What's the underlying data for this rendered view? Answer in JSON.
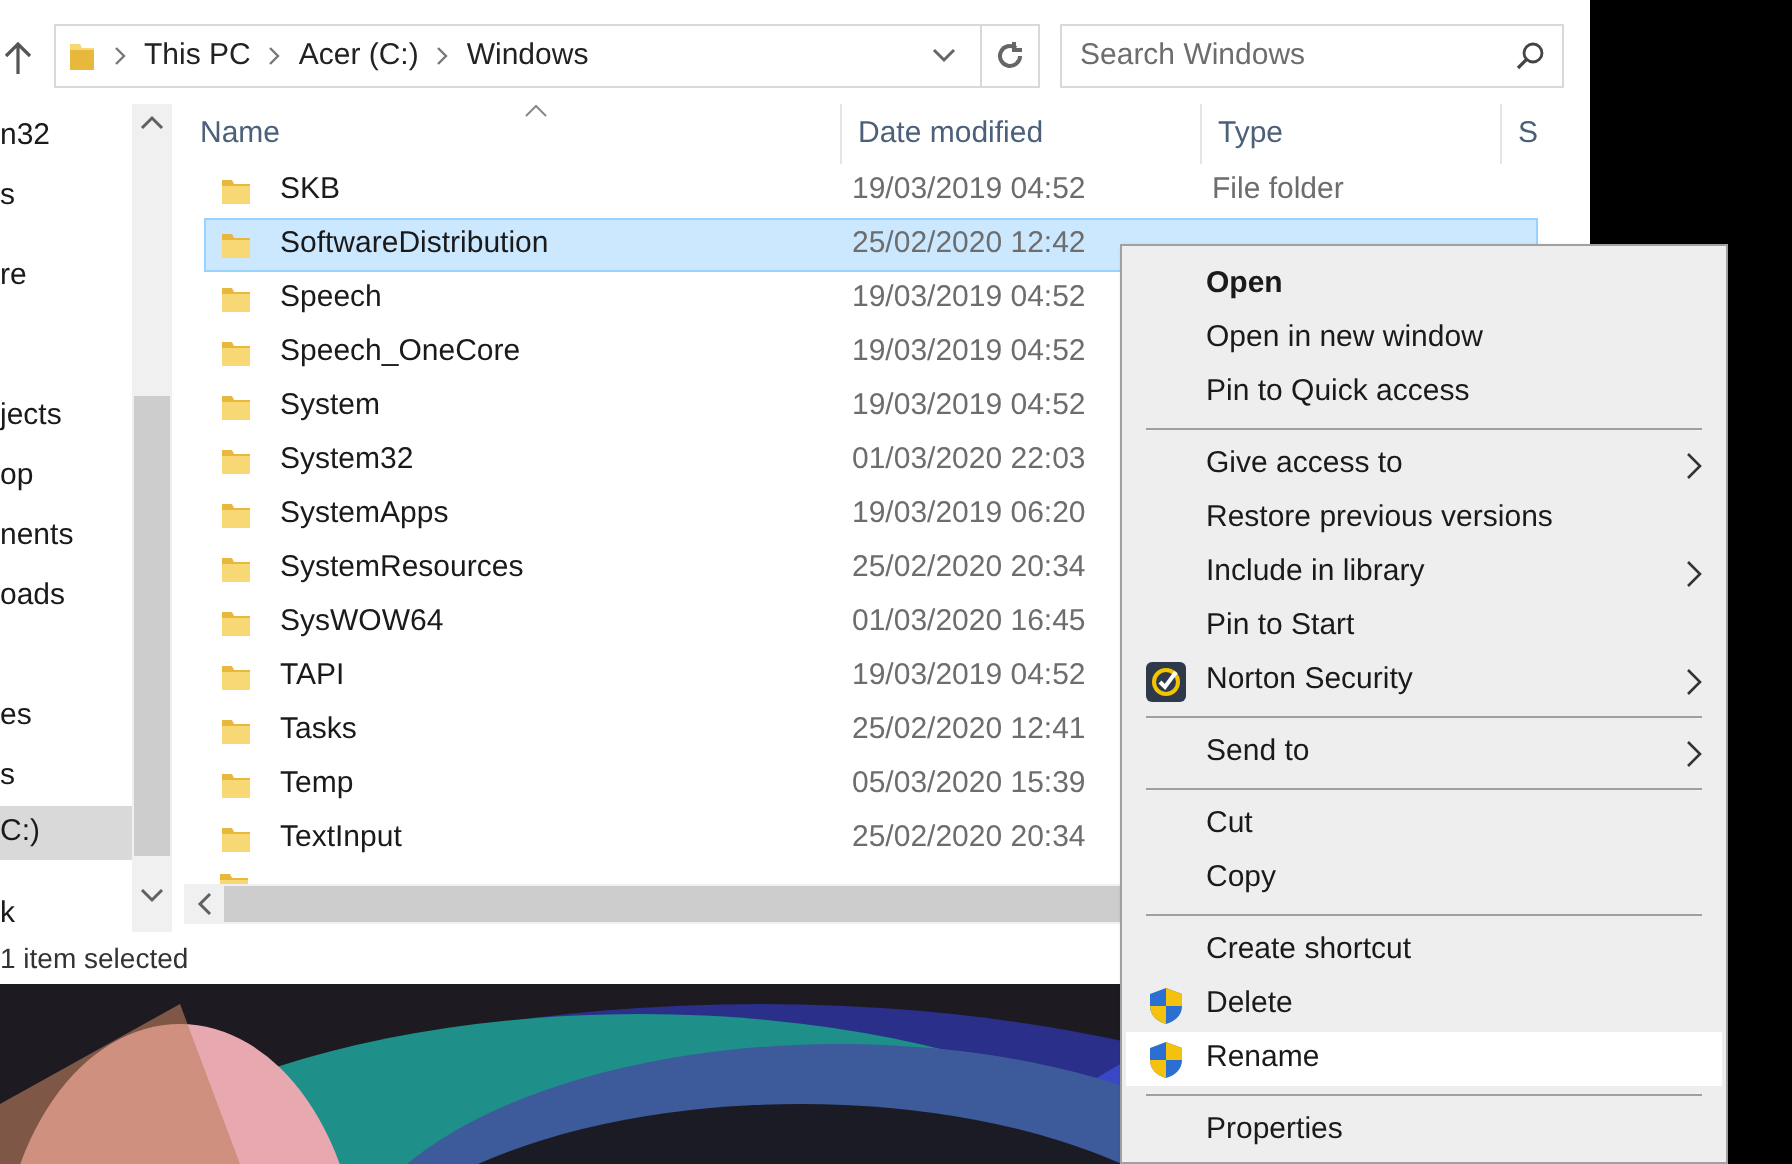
{
  "address_bar": {
    "crumbs": [
      "This PC",
      "Acer (C:)",
      "Windows"
    ]
  },
  "search": {
    "placeholder": "Search Windows"
  },
  "navigation_pane": {
    "items": [
      {
        "label": "n32",
        "selected": false
      },
      {
        "label": "s",
        "selected": false
      },
      {
        "label": "re",
        "selected": false
      },
      {
        "label": "jects",
        "selected": false
      },
      {
        "label": "op",
        "selected": false
      },
      {
        "label": "nents",
        "selected": false
      },
      {
        "label": "oads",
        "selected": false
      },
      {
        "label": "es",
        "selected": false
      },
      {
        "label": "s",
        "selected": false
      },
      {
        "label": "C:)",
        "selected": true
      },
      {
        "label": "k",
        "selected": false
      }
    ]
  },
  "file_list": {
    "columns": [
      "Name",
      "Date modified",
      "Type",
      "S"
    ],
    "rows": [
      {
        "name": "SKB",
        "date": "19/03/2019 04:52",
        "type": "File folder",
        "selected": false
      },
      {
        "name": "SoftwareDistribution",
        "date": "25/02/2020 12:42",
        "selected": true
      },
      {
        "name": "Speech",
        "date": "19/03/2019 04:52",
        "selected": false
      },
      {
        "name": "Speech_OneCore",
        "date": "19/03/2019 04:52",
        "selected": false
      },
      {
        "name": "System",
        "date": "19/03/2019 04:52",
        "selected": false
      },
      {
        "name": "System32",
        "date": "01/03/2020 22:03",
        "selected": false
      },
      {
        "name": "SystemApps",
        "date": "19/03/2019 06:20",
        "selected": false
      },
      {
        "name": "SystemResources",
        "date": "25/02/2020 20:34",
        "selected": false
      },
      {
        "name": "SysWOW64",
        "date": "01/03/2020 16:45",
        "selected": false
      },
      {
        "name": "TAPI",
        "date": "19/03/2019 04:52",
        "selected": false
      },
      {
        "name": "Tasks",
        "date": "25/02/2020 12:41",
        "selected": false
      },
      {
        "name": "Temp",
        "date": "05/03/2020 15:39",
        "selected": false
      },
      {
        "name": "TextInput",
        "date": "25/02/2020 20:34",
        "selected": false
      }
    ]
  },
  "status_bar": {
    "text": "1 item selected"
  },
  "context_menu": {
    "items": [
      {
        "kind": "item",
        "label": "Open",
        "default": true,
        "submenu": false,
        "selected": false
      },
      {
        "kind": "item",
        "label": "Open in new window",
        "default": false,
        "submenu": false,
        "selected": false
      },
      {
        "kind": "item",
        "label": "Pin to Quick access",
        "default": false,
        "submenu": false,
        "selected": false
      },
      {
        "kind": "separator"
      },
      {
        "kind": "item",
        "label": "Give access to",
        "default": false,
        "submenu": true,
        "selected": false
      },
      {
        "kind": "item",
        "label": "Restore previous versions",
        "default": false,
        "submenu": false,
        "selected": false
      },
      {
        "kind": "item",
        "label": "Include in library",
        "default": false,
        "submenu": true,
        "selected": false
      },
      {
        "kind": "item",
        "label": "Pin to Start",
        "default": false,
        "submenu": false,
        "selected": false
      },
      {
        "kind": "norton",
        "label": "Norton Security",
        "default": false,
        "submenu": true,
        "selected": false
      },
      {
        "kind": "separator"
      },
      {
        "kind": "item",
        "label": "Send to",
        "default": false,
        "submenu": true,
        "selected": false
      },
      {
        "kind": "separator"
      },
      {
        "kind": "item",
        "label": "Cut",
        "default": false,
        "submenu": false,
        "selected": false
      },
      {
        "kind": "item",
        "label": "Copy",
        "default": false,
        "submenu": false,
        "selected": false
      },
      {
        "kind": "separator"
      },
      {
        "kind": "item",
        "label": "Create shortcut",
        "default": false,
        "submenu": false,
        "selected": false
      },
      {
        "kind": "shield",
        "label": "Delete",
        "default": false,
        "submenu": false,
        "selected": false
      },
      {
        "kind": "shield",
        "label": "Rename",
        "default": false,
        "submenu": false,
        "selected": true
      },
      {
        "kind": "separator"
      },
      {
        "kind": "item",
        "label": "Properties",
        "default": false,
        "submenu": false,
        "selected": false
      }
    ]
  }
}
